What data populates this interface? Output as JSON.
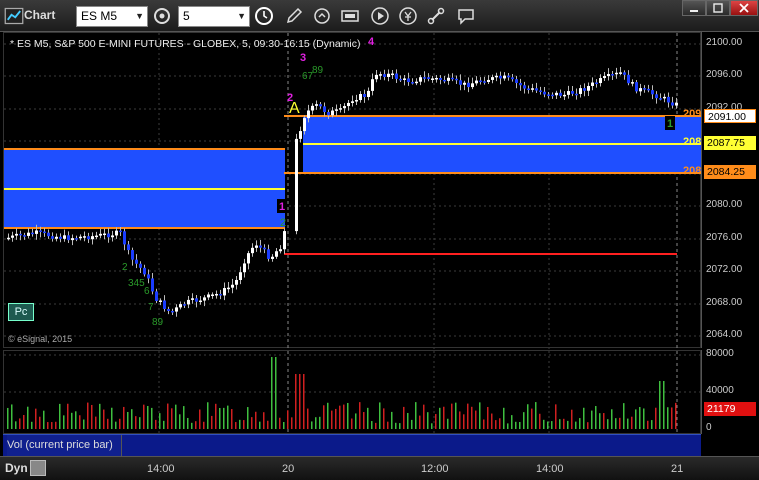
{
  "toolbar": {
    "app_title": "Chart",
    "symbol_value": "ES M5",
    "interval_value": "5"
  },
  "chart": {
    "title": "* ES M5, S&P 500 E-MINI FUTURES - GLOBEX, 5, 09:30-16:15 (Dynamic)",
    "copyright": "© eSignal, 2015",
    "pc_button": "Pc",
    "price_axis": [
      "2100.00",
      "2096.00",
      "2092.00",
      "2088.00",
      "2084.00",
      "2080.00",
      "2076.00",
      "2072.00",
      "2068.00",
      "2064.00"
    ],
    "price_tags": {
      "upper": "2091.00",
      "mid": "2087.75",
      "lower": "2084.25"
    },
    "edge_labels": {
      "upper": "209",
      "mid": "208",
      "lower": "208"
    },
    "annotations": [
      "A",
      "1",
      "2",
      "3",
      "4",
      "1",
      "2"
    ],
    "colors": {
      "zone_fill": "#1f4fff",
      "zone_border": "#ff8c1a",
      "midline": "#ffff33",
      "support": "#ff2020",
      "up_candle": "#ffffff",
      "down_candle": "#1a3cff"
    }
  },
  "volume": {
    "axis": [
      "80000",
      "40000",
      "0"
    ],
    "current_value": "21179",
    "label": "Vol (current price bar)"
  },
  "time_axis": {
    "labels": [
      "14:00",
      "20",
      "12:00",
      "14:00",
      "21"
    ],
    "dyn_label": "Dyn"
  }
}
